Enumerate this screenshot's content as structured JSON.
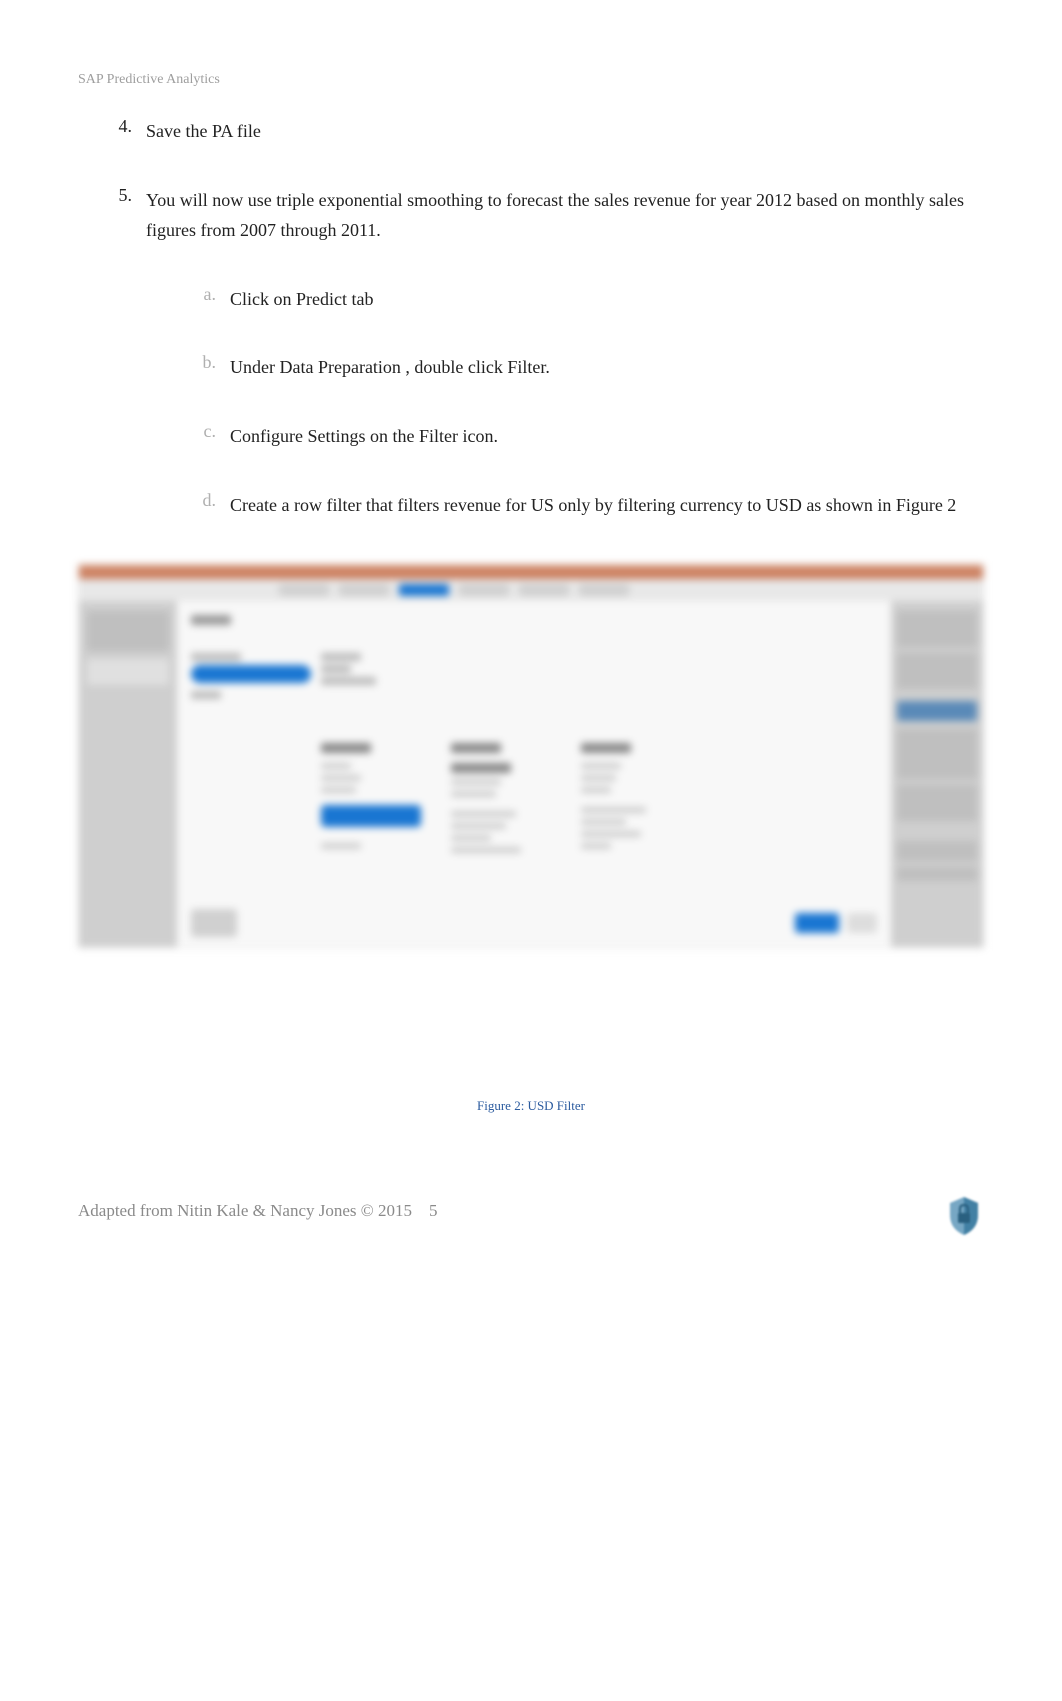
{
  "header": {
    "label": "SAP Predictive Analytics"
  },
  "steps": {
    "four": {
      "num": "4.",
      "text": "Save the PA file"
    },
    "five": {
      "num": "5.",
      "text": "You will now use triple exponential smoothing to forecast the sales revenue for year 2012 based on monthly sales figures from 2007 through 2011.",
      "sub": {
        "a": {
          "letter": "a.",
          "text": "Click on Predict tab"
        },
        "b": {
          "letter": "b.",
          "text": "Under Data Preparation , double click Filter."
        },
        "c": {
          "letter": "c.",
          "text": "Configure Settings on the Filter icon."
        },
        "d": {
          "letter": "d.",
          "text": "Create a row filter that filters revenue for US only by filtering currency to USD as shown in Figure 2"
        }
      }
    }
  },
  "figure": {
    "caption": "Figure 2: USD Filter"
  },
  "footer": {
    "text": "Adapted from Nitin Kale & Nancy Jones © 2015",
    "page": "5"
  }
}
